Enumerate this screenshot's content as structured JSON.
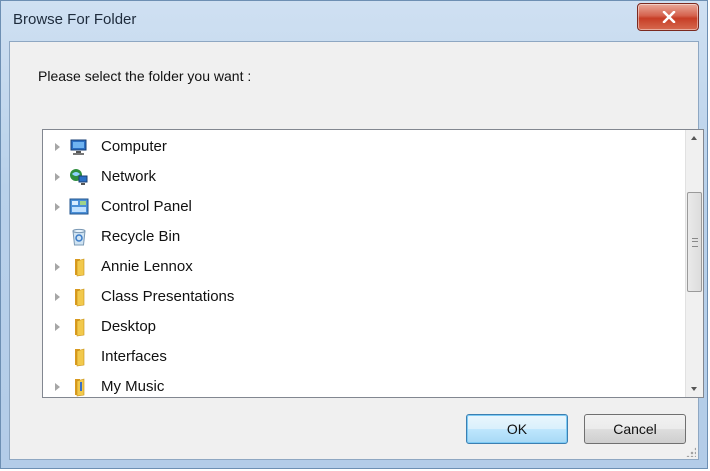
{
  "window": {
    "title": "Browse For Folder"
  },
  "prompt": "Please select the folder you want :",
  "tree": {
    "items": [
      {
        "label": "Computer",
        "icon": "computer-icon",
        "expandable": true
      },
      {
        "label": "Network",
        "icon": "network-icon",
        "expandable": true
      },
      {
        "label": "Control Panel",
        "icon": "control-panel-icon",
        "expandable": true
      },
      {
        "label": "Recycle Bin",
        "icon": "recycle-bin-icon",
        "expandable": false
      },
      {
        "label": "Annie Lennox",
        "icon": "folder-icon",
        "expandable": true
      },
      {
        "label": "Class Presentations",
        "icon": "folder-icon",
        "expandable": true
      },
      {
        "label": "Desktop",
        "icon": "folder-icon",
        "expandable": true
      },
      {
        "label": "Interfaces",
        "icon": "folder-icon",
        "expandable": false
      },
      {
        "label": "My Music",
        "icon": "music-folder-icon",
        "expandable": true
      }
    ]
  },
  "buttons": {
    "ok_label": "OK",
    "cancel_label": "Cancel"
  },
  "colors": {
    "title_bar": "#b9d1ea",
    "close_button": "#c73e26",
    "ok_button_border": "#3c7fb1",
    "folder": "#e8b73a"
  }
}
